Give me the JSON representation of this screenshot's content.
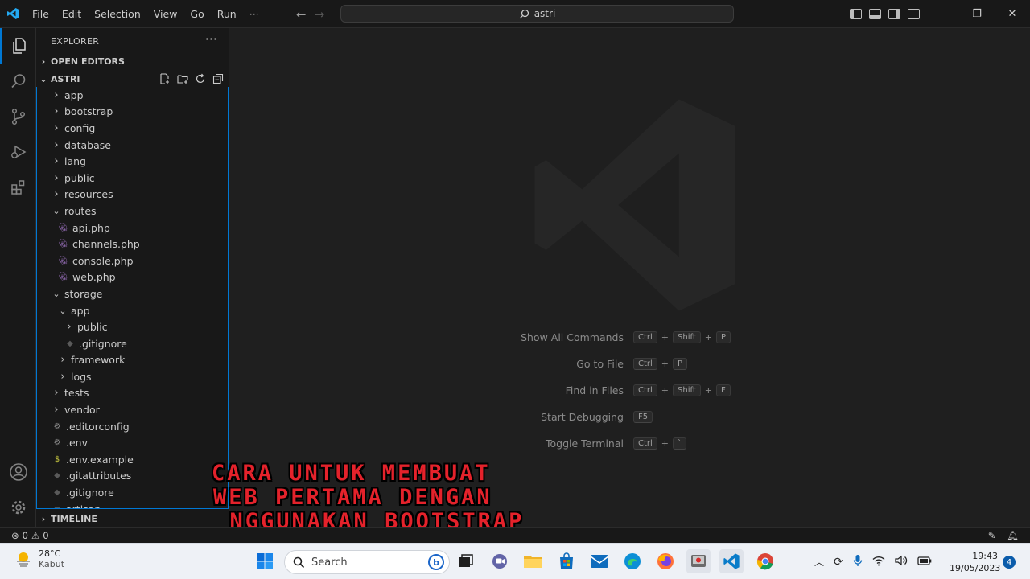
{
  "titlebar": {
    "menu": [
      "File",
      "Edit",
      "Selection",
      "View",
      "Go",
      "Run",
      "···"
    ],
    "search": "astri",
    "controls": [
      "—",
      "❐",
      "✕"
    ]
  },
  "sidebar": {
    "title": "EXPLORER",
    "more": "···",
    "open_editors": "OPEN EDITORS",
    "project": "ASTRI",
    "tree": [
      {
        "label": "app",
        "kind": "folder",
        "open": false,
        "depth": 0
      },
      {
        "label": "bootstrap",
        "kind": "folder",
        "open": false,
        "depth": 0
      },
      {
        "label": "config",
        "kind": "folder",
        "open": false,
        "depth": 0
      },
      {
        "label": "database",
        "kind": "folder",
        "open": false,
        "depth": 0
      },
      {
        "label": "lang",
        "kind": "folder",
        "open": false,
        "depth": 0
      },
      {
        "label": "public",
        "kind": "folder",
        "open": false,
        "depth": 0
      },
      {
        "label": "resources",
        "kind": "folder",
        "open": false,
        "depth": 0
      },
      {
        "label": "routes",
        "kind": "folder",
        "open": true,
        "depth": 0
      },
      {
        "label": "api.php",
        "kind": "php",
        "depth": 1
      },
      {
        "label": "channels.php",
        "kind": "php",
        "depth": 1
      },
      {
        "label": "console.php",
        "kind": "php",
        "depth": 1
      },
      {
        "label": "web.php",
        "kind": "php",
        "depth": 1
      },
      {
        "label": "storage",
        "kind": "folder",
        "open": true,
        "depth": 0
      },
      {
        "label": "app",
        "kind": "folder",
        "open": true,
        "depth": 1
      },
      {
        "label": "public",
        "kind": "folder",
        "open": false,
        "depth": 2
      },
      {
        "label": ".gitignore",
        "kind": "git",
        "depth": 2
      },
      {
        "label": "framework",
        "kind": "folder",
        "open": false,
        "depth": 1
      },
      {
        "label": "logs",
        "kind": "folder",
        "open": false,
        "depth": 1
      },
      {
        "label": "tests",
        "kind": "folder",
        "open": false,
        "depth": 0
      },
      {
        "label": "vendor",
        "kind": "folder",
        "open": false,
        "depth": 0
      },
      {
        "label": ".editorconfig",
        "kind": "gear",
        "depth": 0
      },
      {
        "label": ".env",
        "kind": "gear",
        "depth": 0
      },
      {
        "label": ".env.example",
        "kind": "dollar",
        "depth": 0
      },
      {
        "label": ".gitattributes",
        "kind": "git",
        "depth": 0
      },
      {
        "label": ".gitignore",
        "kind": "git",
        "depth": 0
      },
      {
        "label": "artisan",
        "kind": "file",
        "depth": 0
      }
    ],
    "timeline": "TIMELINE"
  },
  "editor": {
    "shortcuts": [
      {
        "label": "Show All Commands",
        "keys": [
          "Ctrl",
          "Shift",
          "P"
        ]
      },
      {
        "label": "Go to File",
        "keys": [
          "Ctrl",
          "P"
        ]
      },
      {
        "label": "Find in Files",
        "keys": [
          "Ctrl",
          "Shift",
          "F"
        ]
      },
      {
        "label": "Start Debugging",
        "keys": [
          "F5"
        ]
      },
      {
        "label": "Toggle Terminal",
        "keys": [
          "Ctrl",
          "`"
        ]
      }
    ]
  },
  "caption": {
    "line1": "CARA UNTUK MEMBUAT",
    "line2": "WEB PERTAMA DENGAN",
    "line3": "MENGGUNAKAN BOOTSTRAP"
  },
  "statusbar": {
    "errors": "0",
    "warnings": "0"
  },
  "taskbar": {
    "weather_temp": "28°C",
    "weather_desc": "Kabut",
    "search_placeholder": "Search",
    "time": "19:43",
    "date": "19/05/2023",
    "notifications": "4"
  },
  "colors": {
    "accent": "#0078d4",
    "php_icon": "#a074c4",
    "caption": "#e4222b"
  }
}
